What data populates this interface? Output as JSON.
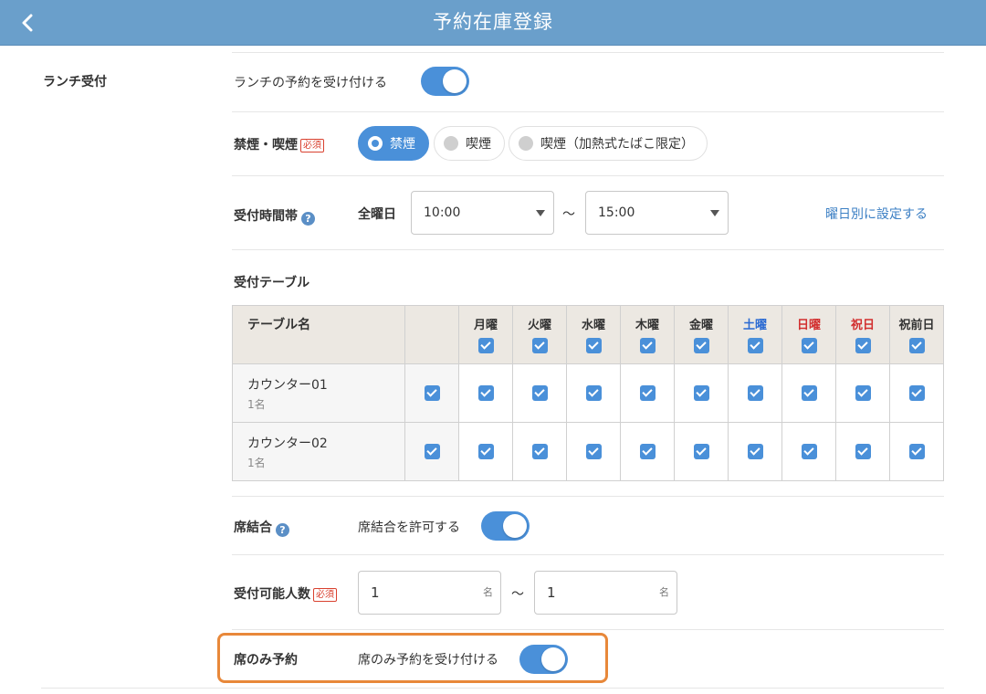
{
  "header": {
    "title": "予約在庫登録"
  },
  "section": {
    "label": "ランチ受付"
  },
  "lunch": {
    "toggle_label": "ランチの予約を受け付ける",
    "enabled": true
  },
  "smoking": {
    "label": "禁煙・喫煙",
    "required": "必須",
    "options": [
      {
        "label": "禁煙",
        "selected": true
      },
      {
        "label": "喫煙",
        "selected": false
      },
      {
        "label": "喫煙（加熱式たばこ限定）",
        "selected": false
      }
    ]
  },
  "reception_time": {
    "label": "受付時間帯",
    "help": "?",
    "day_label": "全曜日",
    "start": "10:00",
    "tilde": "〜",
    "end": "15:00",
    "link": "曜日別に設定する"
  },
  "tables": {
    "label": "受付テーブル",
    "header_name": "テーブル名",
    "days": [
      "月曜",
      "火曜",
      "水曜",
      "木曜",
      "金曜",
      "土曜",
      "日曜",
      "祝日",
      "祝前日"
    ],
    "day_colors": {
      "土曜": "#2a6ad3",
      "日曜": "#d22f2f",
      "祝日": "#d22f2f"
    },
    "rows": [
      {
        "name": "カウンター01",
        "capacity": "1名"
      },
      {
        "name": "カウンター02",
        "capacity": "1名"
      }
    ]
  },
  "shared_seat": {
    "label": "席結合",
    "help": "?",
    "toggle_label": "席結合を許可する",
    "enabled": true
  },
  "capacity": {
    "label": "受付可能人数",
    "required": "必須",
    "min": "1",
    "max": "1",
    "unit": "名",
    "tilde": "〜"
  },
  "seat_only": {
    "label": "席のみ予約",
    "toggle_label": "席のみ予約を受け付ける",
    "enabled": true
  },
  "colors": {
    "header": "#6a9fcb",
    "accent": "#4a90d9",
    "highlight": "#e8883a",
    "required": "#d9412f"
  }
}
